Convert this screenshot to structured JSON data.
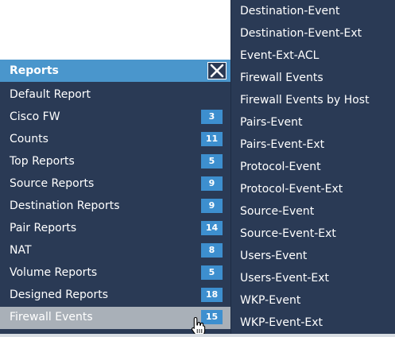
{
  "reports_panel": {
    "title": "Reports",
    "close_icon": "close-icon",
    "items": [
      {
        "label": "Default Report",
        "count": null
      },
      {
        "label": "Cisco FW",
        "count": "3"
      },
      {
        "label": "Counts",
        "count": "11"
      },
      {
        "label": "Top Reports",
        "count": "5"
      },
      {
        "label": "Source Reports",
        "count": "9"
      },
      {
        "label": "Destination Reports",
        "count": "9"
      },
      {
        "label": "Pair Reports",
        "count": "14"
      },
      {
        "label": "NAT",
        "count": "8"
      },
      {
        "label": "Volume Reports",
        "count": "5"
      },
      {
        "label": "Designed Reports",
        "count": "18"
      },
      {
        "label": "Firewall Events",
        "count": "15"
      }
    ]
  },
  "submenu": {
    "items": [
      "Destination-Event",
      "Destination-Event-Ext",
      "Event-Ext-ACL",
      "Firewall Events",
      "Firewall Events by Host",
      "Pairs-Event",
      "Pairs-Event-Ext",
      "Protocol-Event",
      "Protocol-Event-Ext",
      "Source-Event",
      "Source-Event-Ext",
      "Users-Event",
      "Users-Event-Ext",
      "WKP-Event",
      "WKP-Event-Ext"
    ]
  },
  "colors": {
    "panel_bg": "#2a3a55",
    "header_bg": "#4a96cc",
    "badge_bg": "#3d8fcf",
    "hover_bg": "#a9b0b8"
  },
  "cursor_icon": "hand-pointer-icon"
}
